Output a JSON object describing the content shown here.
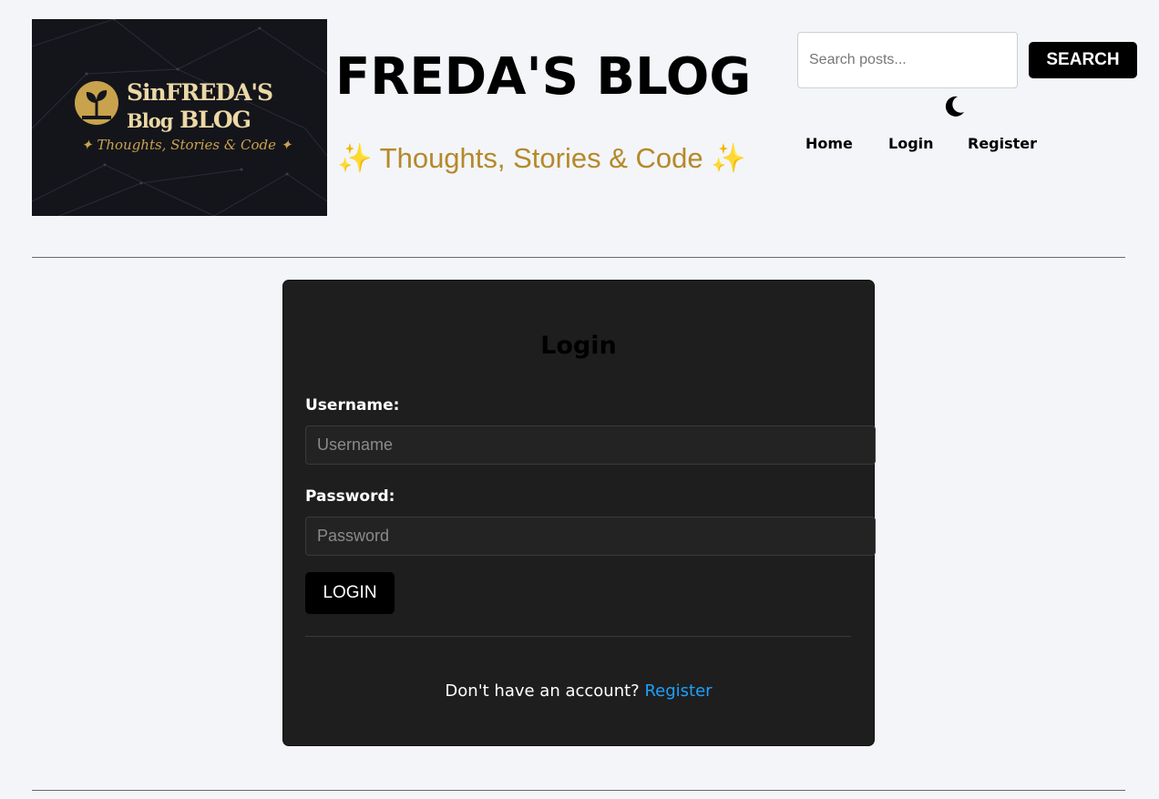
{
  "logo": {
    "line1": "SinFREDA'S",
    "line2_small": "Blog",
    "line2_big": "BLOG",
    "line3": "✦ Thoughts, Stories & Code ✦"
  },
  "header": {
    "title": "FREDA'S BLOG",
    "tagline": "✨ Thoughts, Stories & Code ✨"
  },
  "search": {
    "placeholder": "Search posts...",
    "button_label": "SEARCH"
  },
  "theme_toggle": {
    "icon": "moon-icon"
  },
  "nav": {
    "items": [
      {
        "label": "Home"
      },
      {
        "label": "Login"
      },
      {
        "label": "Register"
      }
    ]
  },
  "login": {
    "title": "Login",
    "username_label": "Username:",
    "username_placeholder": "Username",
    "password_label": "Password:",
    "password_placeholder": "Password",
    "button_label": "LOGIN",
    "register_prompt": "Don't have an account?",
    "register_link": "Register"
  },
  "colors": {
    "page_bg": "#f3f5f8",
    "card_bg": "#1e1e1e",
    "accent_gold": "#b5892a",
    "link_blue": "#1fa0ff"
  }
}
